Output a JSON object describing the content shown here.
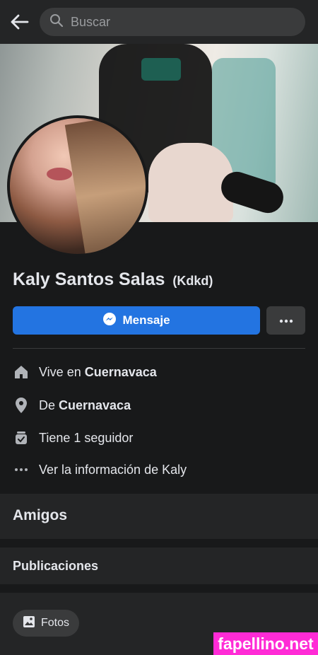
{
  "search": {
    "placeholder": "Buscar"
  },
  "profile": {
    "name": "Kaly Santos Salas",
    "nickname": "(Kdkd)",
    "message_button": "Mensaje"
  },
  "info": [
    {
      "icon": "home-icon",
      "prefix": "Vive en ",
      "value": "Cuernavaca"
    },
    {
      "icon": "location-pin-icon",
      "prefix": "De ",
      "value": "Cuernavaca"
    },
    {
      "icon": "followers-icon",
      "text": "Tiene 1 seguidor"
    },
    {
      "icon": "more-dots-icon",
      "text": "Ver la información de Kaly"
    }
  ],
  "sections": {
    "friends_title": "Amigos",
    "posts_title": "Publicaciones",
    "photos_chip": "Fotos"
  },
  "watermark": "fapellino.net",
  "colors": {
    "background": "#18191a",
    "surface": "#242526",
    "accent": "#2374e1",
    "watermark": "#ff2bd6"
  }
}
